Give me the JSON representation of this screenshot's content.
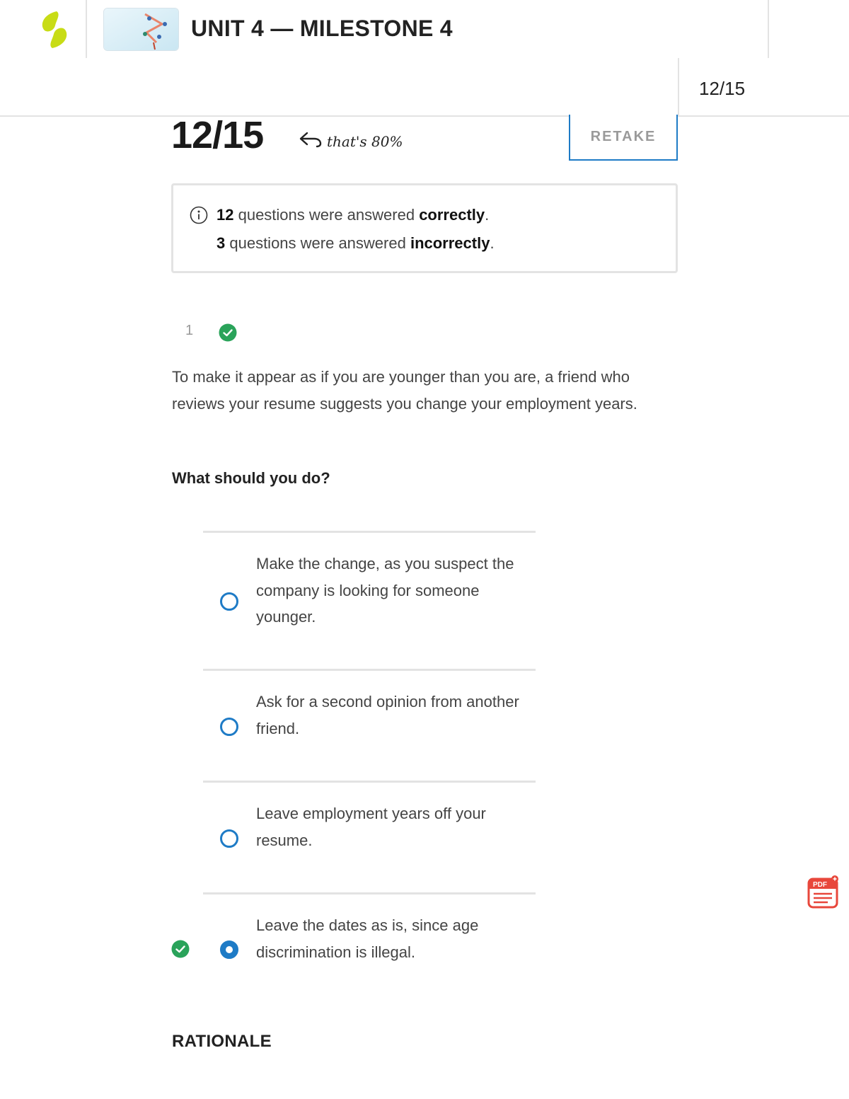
{
  "header": {
    "title": "UNIT 4 — MILESTONE 4",
    "score": "12/15"
  },
  "result": {
    "score": "12/15",
    "percent_note": "that's 80%",
    "retake_label": "RETAKE"
  },
  "summary": {
    "correct_count": "12",
    "correct_text": " questions were answered ",
    "correct_word": "correctly",
    "correct_end": ".",
    "incorrect_count": "3",
    "incorrect_text": " questions were answered ",
    "incorrect_word": "incorrectly",
    "incorrect_end": "."
  },
  "question": {
    "number": "1",
    "status": "correct",
    "text": "To make it appear as if you are younger than you are, a friend who reviews your resume suggests you change your employment years.",
    "prompt": "What should you do?",
    "options": [
      {
        "label": "Make the change, as you suspect the company is looking for someone younger.",
        "selected": false
      },
      {
        "label": "Ask for a second opinion from another friend.",
        "selected": false
      },
      {
        "label": "Leave employment years off your resume.",
        "selected": false
      },
      {
        "label": "Leave the dates as is, since age discrimination is illegal.",
        "selected": true,
        "correct": true
      }
    ]
  },
  "rationale_heading": "RATIONALE",
  "colors": {
    "accent": "#1e7bc6",
    "correct_green": "#2aa35a",
    "brand_lime": "#c8dc16",
    "pdf_red": "#e8473b"
  },
  "icons": [
    "brand-logo-icon",
    "undo-arrow-icon",
    "info-icon",
    "check-circle-icon",
    "pdf-icon"
  ]
}
